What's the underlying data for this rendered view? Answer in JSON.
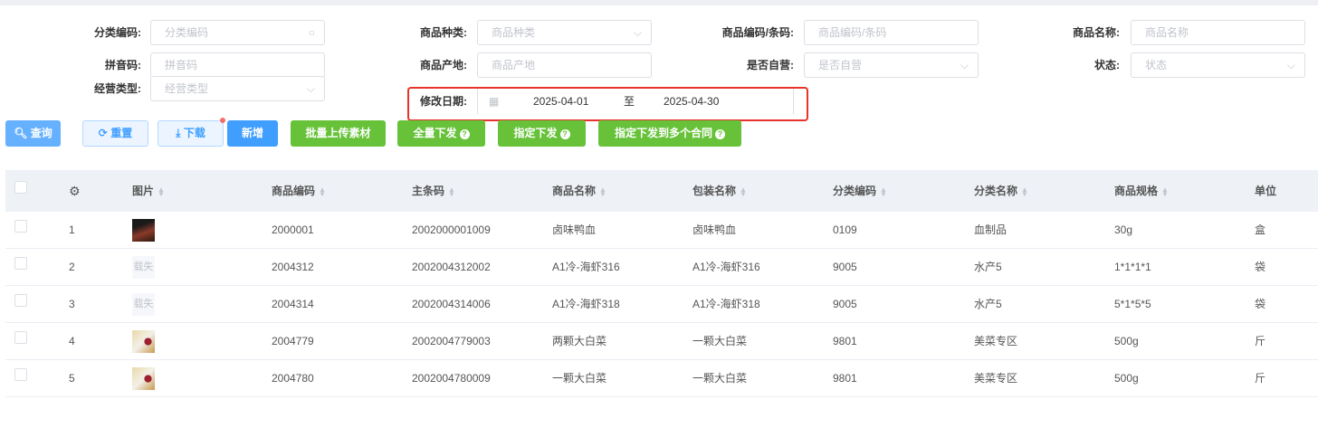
{
  "filters": [
    {
      "label": "分类编码:",
      "placeholder": "分类编码",
      "icon": "search-icon"
    },
    {
      "label": "商品种类:",
      "placeholder": "商品种类",
      "icon": "chevron-down-icon"
    },
    {
      "label": "商品编码/条码:",
      "placeholder": "商品编码/条码"
    },
    {
      "label": "商品名称:",
      "placeholder": "商品名称"
    },
    {
      "label": "拼音码:",
      "placeholder": "拼音码"
    },
    {
      "label": "商品产地:",
      "placeholder": "商品产地"
    },
    {
      "label": "是否自营:",
      "placeholder": "是否自营",
      "icon": "chevron-down-icon"
    },
    {
      "label": "状态:",
      "placeholder": "状态",
      "icon": "chevron-down-icon"
    },
    {
      "label": "经营类型:",
      "placeholder": "经营类型",
      "icon": "chevron-down-icon"
    }
  ],
  "date": {
    "label": "修改日期:",
    "start": "2025-04-01",
    "sep": "至",
    "end": "2025-04-30"
  },
  "buttons": {
    "query": "查询",
    "reset": "重置",
    "download": "下载",
    "add": "新增",
    "batch_upload": "批量上传素材",
    "full_dispatch": "全量下发",
    "assign_dispatch": "指定下发",
    "assign_multi": "指定下发到多个合同",
    "help": "?"
  },
  "table": {
    "columns": [
      "图片",
      "商品编码",
      "主条码",
      "商品名称",
      "包装名称",
      "分类编码",
      "分类名称",
      "商品规格",
      "单位"
    ],
    "rows": [
      {
        "idx": "1",
        "img": "meat",
        "code": "2000001",
        "barcode": "2002000001009",
        "name": "卤味鸭血",
        "pack": "卤味鸭血",
        "catcode": "0109",
        "catname": "血制品",
        "spec": "30g",
        "unit": "盒"
      },
      {
        "idx": "2",
        "img": "载失",
        "code": "2004312",
        "barcode": "2002004312002",
        "name": "A1冷-海虾316",
        "pack": "A1冷-海虾316",
        "catcode": "9005",
        "catname": "水产5",
        "spec": "1*1*1*1",
        "unit": "袋"
      },
      {
        "idx": "3",
        "img": "载失",
        "code": "2004314",
        "barcode": "2002004314006",
        "name": "A1冷-海虾318",
        "pack": "A1冷-海虾318",
        "catcode": "9005",
        "catname": "水产5",
        "spec": "5*1*5*5",
        "unit": "袋"
      },
      {
        "idx": "4",
        "img": "veg",
        "code": "2004779",
        "barcode": "2002004779003",
        "name": "两颗大白菜",
        "pack": "一颗大白菜",
        "catcode": "9801",
        "catname": "美菜专区",
        "spec": "500g",
        "unit": "斤"
      },
      {
        "idx": "5",
        "img": "veg",
        "code": "2004780",
        "barcode": "2002004780009",
        "name": "一颗大白菜",
        "pack": "一颗大白菜",
        "catcode": "9801",
        "catname": "美菜专区",
        "spec": "500g",
        "unit": "斤"
      }
    ]
  }
}
